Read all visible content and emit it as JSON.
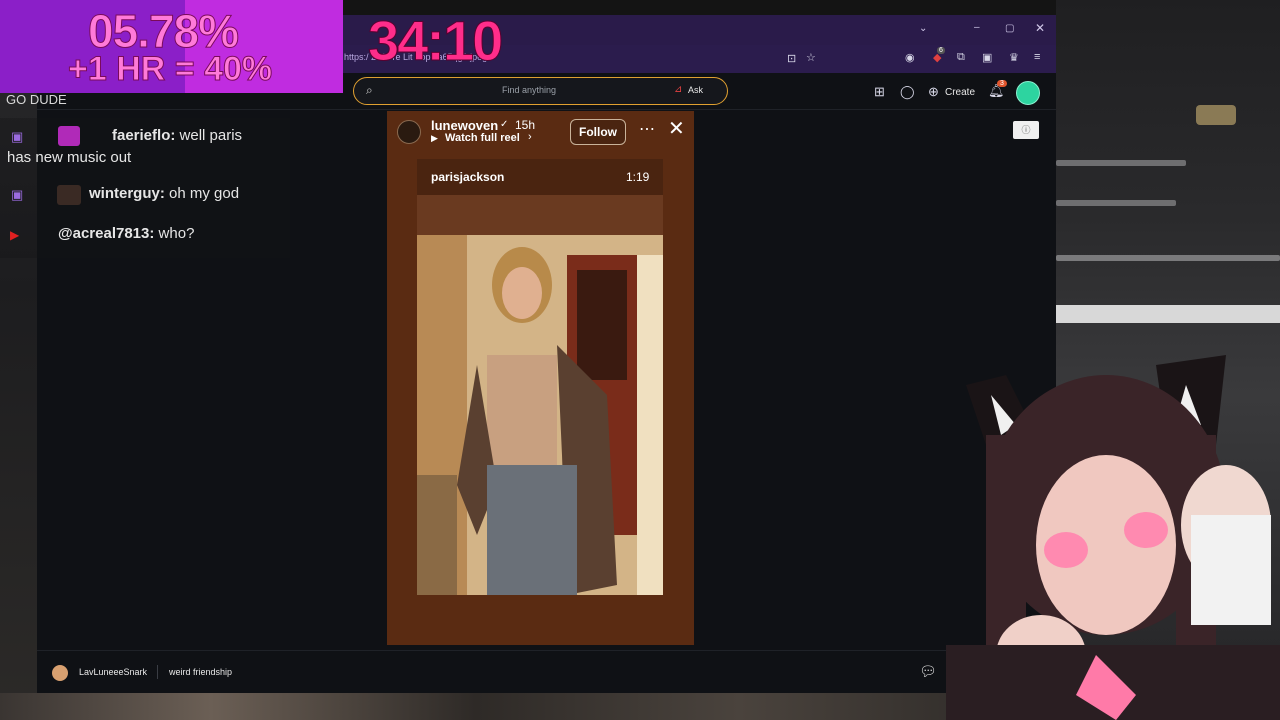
{
  "overlay": {
    "percent": "05.78%",
    "hour_bonus": "+1 HR = 40%",
    "timer": "34:10",
    "header_text": "GO DUDE"
  },
  "chat": [
    {
      "platform": "twitch",
      "user": "faerieflo:",
      "message": "well paris",
      "message_cont": "has new music out"
    },
    {
      "platform": "twitch",
      "user": "winterguy:",
      "message": "oh my god"
    },
    {
      "platform": "youtube",
      "user": "@acreal7813:",
      "message": "who?"
    }
  ],
  "browser": {
    "url_fragment": "https:/  2P%   re  Lit   Fop   Ja65qg1.jpeg",
    "search_placeholder": "Find anything",
    "ask_label": "Ask",
    "create_label": "Create",
    "notification_count": "3",
    "extension_badge": "6"
  },
  "story": {
    "username": "lunewoven",
    "time_ago": "15h",
    "watch_label": "Watch full reel",
    "follow_label": "Follow",
    "reel_author": "parisjackson",
    "reel_duration": "1:19"
  },
  "bottom_bar": {
    "user": "LavLuneeeSnark",
    "title": "weird friendship"
  },
  "colors": {
    "accent_search_border": "#e0a030",
    "story_bg": "#5a2b12",
    "titlebar": "#2a1b4a",
    "overlay_purple": "#c02ce0",
    "timer": "#ff2d8a",
    "avatar_green": "#2dd4a0"
  }
}
